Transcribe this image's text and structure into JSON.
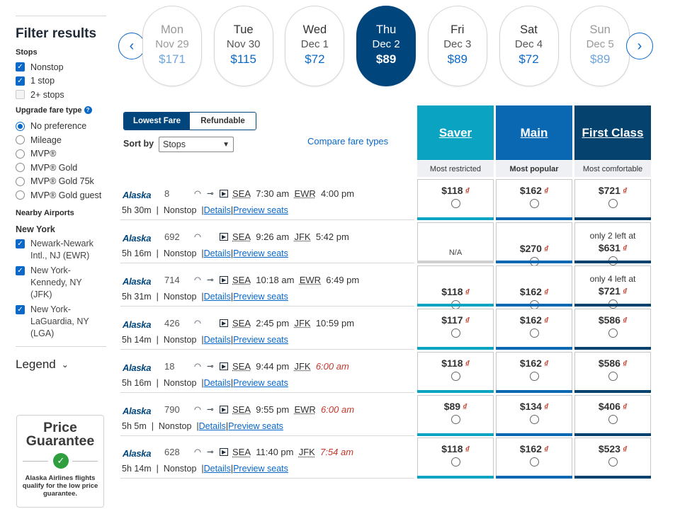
{
  "filters": {
    "title": "Filter results",
    "stops_heading": "Stops",
    "stops": [
      {
        "label": "Nonstop",
        "checked": true
      },
      {
        "label": "1 stop",
        "checked": true
      },
      {
        "label": "2+ stops",
        "checked": false
      }
    ],
    "upgrade_heading": "Upgrade fare type",
    "upgrade_options": [
      {
        "label": "No preference",
        "selected": true
      },
      {
        "label": "Mileage",
        "selected": false
      },
      {
        "label": "MVP®",
        "selected": false
      },
      {
        "label": "MVP® Gold",
        "selected": false
      },
      {
        "label": "MVP® Gold 75k",
        "selected": false
      },
      {
        "label": "MVP® Gold guest",
        "selected": false
      }
    ],
    "nearby_heading": "Nearby Airports",
    "city": "New York",
    "airports": [
      {
        "label": "Newark-Newark Intl., NJ (EWR)",
        "lines": [
          "Newark-Newark",
          "Intl., NJ (EWR)"
        ],
        "checked": true
      },
      {
        "label": "New York-Kennedy, NY (JFK)",
        "lines": [
          "New York-",
          "Kennedy, NY",
          "(JFK)"
        ],
        "checked": true
      },
      {
        "label": "New York-LaGuardia, NY (LGA)",
        "lines": [
          "New York-",
          "LaGuardia, NY",
          "(LGA)"
        ],
        "checked": true
      }
    ],
    "legend_label": "Legend"
  },
  "price_guarantee": {
    "title_line1": "Price",
    "title_line2": "Guarantee",
    "description": "Alaska Airlines flights qualify for the low price guarantee."
  },
  "dates": [
    {
      "day": "Mon",
      "date": "Nov 29",
      "price": "$171",
      "selected": false
    },
    {
      "day": "Tue",
      "date": "Nov 30",
      "price": "$115",
      "selected": false
    },
    {
      "day": "Wed",
      "date": "Dec 1",
      "price": "$72",
      "selected": false
    },
    {
      "day": "Thu",
      "date": "Dec 2",
      "price": "$89",
      "selected": true
    },
    {
      "day": "Fri",
      "date": "Dec 3",
      "price": "$89",
      "selected": false
    },
    {
      "day": "Sat",
      "date": "Dec 4",
      "price": "$72",
      "selected": false
    },
    {
      "day": "Sun",
      "date": "Dec 5",
      "price": "$89",
      "selected": false
    }
  ],
  "toggle": {
    "lowest": "Lowest Fare",
    "refundable": "Refundable"
  },
  "sort": {
    "label": "Sort by",
    "value": "Stops"
  },
  "compare_link": "Compare fare types",
  "fare_types": [
    {
      "name": "Saver",
      "subtitle": "Most restricted",
      "color": "#0aa3c2",
      "bar": "#0aa3c2"
    },
    {
      "name": "Main",
      "subtitle": "Most popular",
      "color": "#0a68b3",
      "bar": "#0a68b3"
    },
    {
      "name": "First Class",
      "subtitle": "Most comfortable",
      "color": "#06426e",
      "bar": "#06426e"
    }
  ],
  "flights": [
    {
      "airline": "Alaska",
      "number": "8",
      "from": "SEA",
      "dep": "7:30 am",
      "to": "EWR",
      "arr": "4:00 pm",
      "arr_next_day": false,
      "duration": "5h 30m",
      "stops": "Nonstop",
      "prices": [
        {
          "amount": "$118",
          "note": ""
        },
        {
          "amount": "$162",
          "note": ""
        },
        {
          "amount": "$721",
          "note": ""
        }
      ]
    },
    {
      "airline": "Alaska",
      "number": "692",
      "from": "SEA",
      "dep": "9:26 am",
      "to": "JFK",
      "arr": "5:42 pm",
      "arr_next_day": false,
      "duration": "5h 16m",
      "stops": "Nonstop",
      "prices": [
        {
          "amount": "N/A",
          "note": ""
        },
        {
          "amount": "$270",
          "note": ""
        },
        {
          "amount": "$631",
          "note": "only 2 left at"
        }
      ]
    },
    {
      "airline": "Alaska",
      "number": "714",
      "from": "SEA",
      "dep": "10:18 am",
      "to": "EWR",
      "arr": "6:49 pm",
      "arr_next_day": false,
      "duration": "5h 31m",
      "stops": "Nonstop",
      "prices": [
        {
          "amount": "$118",
          "note": ""
        },
        {
          "amount": "$162",
          "note": ""
        },
        {
          "amount": "$721",
          "note": "only 4 left at"
        }
      ]
    },
    {
      "airline": "Alaska",
      "number": "426",
      "from": "SEA",
      "dep": "2:45 pm",
      "to": "JFK",
      "arr": "10:59 pm",
      "arr_next_day": false,
      "duration": "5h 14m",
      "stops": "Nonstop",
      "prices": [
        {
          "amount": "$117",
          "note": ""
        },
        {
          "amount": "$162",
          "note": ""
        },
        {
          "amount": "$586",
          "note": ""
        }
      ]
    },
    {
      "airline": "Alaska",
      "number": "18",
      "from": "SEA",
      "dep": "9:44 pm",
      "to": "JFK",
      "arr": "6:00 am",
      "arr_next_day": true,
      "duration": "5h 16m",
      "stops": "Nonstop",
      "prices": [
        {
          "amount": "$118",
          "note": ""
        },
        {
          "amount": "$162",
          "note": ""
        },
        {
          "amount": "$586",
          "note": ""
        }
      ]
    },
    {
      "airline": "Alaska",
      "number": "790",
      "from": "SEA",
      "dep": "9:55 pm",
      "to": "EWR",
      "arr": "6:00 am",
      "arr_next_day": true,
      "duration": "5h 5m",
      "stops": "Nonstop",
      "prices": [
        {
          "amount": "$89",
          "note": ""
        },
        {
          "amount": "$134",
          "note": ""
        },
        {
          "amount": "$406",
          "note": ""
        }
      ]
    },
    {
      "airline": "Alaska",
      "number": "628",
      "from": "SEA",
      "dep": "11:40 pm",
      "to": "JFK",
      "arr": "7:54 am",
      "arr_next_day": true,
      "duration": "5h 14m",
      "stops": "Nonstop",
      "prices": [
        {
          "amount": "$118",
          "note": ""
        },
        {
          "amount": "$162",
          "note": ""
        },
        {
          "amount": "$523",
          "note": ""
        }
      ]
    }
  ],
  "links": {
    "details": "Details",
    "preview": "Preview seats"
  },
  "icons": [
    "wifi-icon",
    "power-icon",
    "streaming-icon",
    "chevron-left-icon",
    "chevron-right-icon",
    "checkmark-icon"
  ]
}
